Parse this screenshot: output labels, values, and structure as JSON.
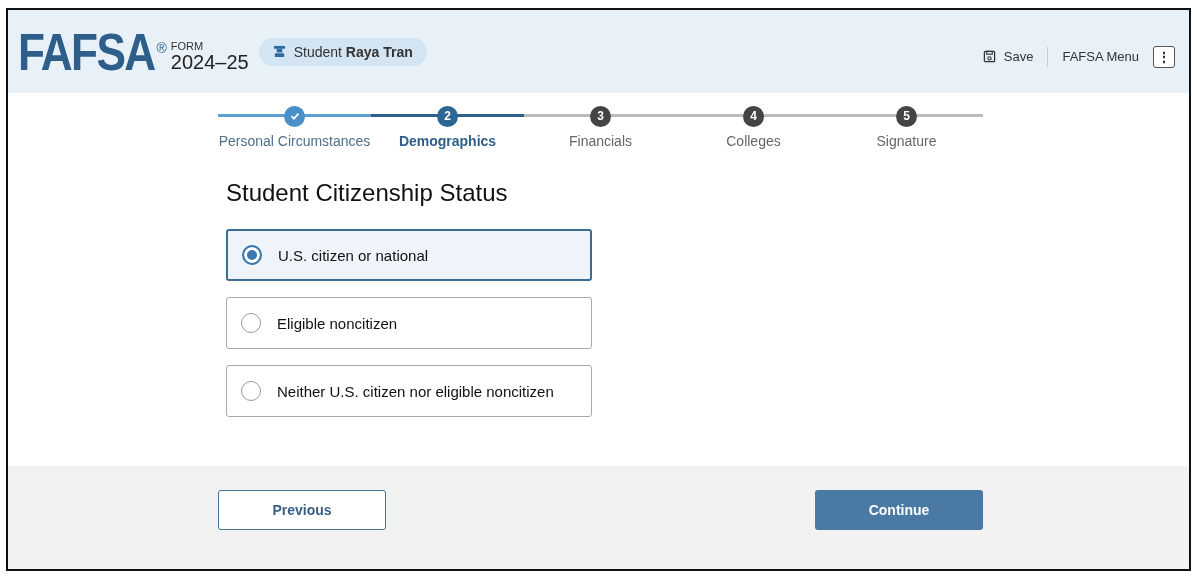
{
  "header": {
    "logo": "FAFSA",
    "registered": "®",
    "form_label": "FORM",
    "form_year": "2024–25",
    "student": "Student **Raya Tran**",
    "save": "Save",
    "menu": "FAFSA Menu",
    "menu_button": "⋮"
  },
  "steps": [
    {
      "label": "Personal Circumstances",
      "completed": true,
      "selected": false
    },
    {
      "label": "Demographics",
      "number": "2",
      "completed": false,
      "selected": true
    },
    {
      "label": "Financials",
      "number": "3",
      "completed": false,
      "selected": false
    },
    {
      "label": "Colleges",
      "number": "4",
      "completed": false,
      "selected": false
    },
    {
      "label": "Signature",
      "number": "5",
      "completed": false,
      "selected": false
    }
  ],
  "question": {
    "title": "Student Citizenship Status",
    "options": [
      {
        "label": "U.S. citizen or national",
        "selected": true
      },
      {
        "label": "Eligible noncitizen",
        "selected": false
      },
      {
        "label": "Neither U.S. citizen nor eligible noncitizen",
        "selected": false
      }
    ]
  },
  "footer": {
    "previous": "Previous",
    "continue": "Continue"
  }
}
